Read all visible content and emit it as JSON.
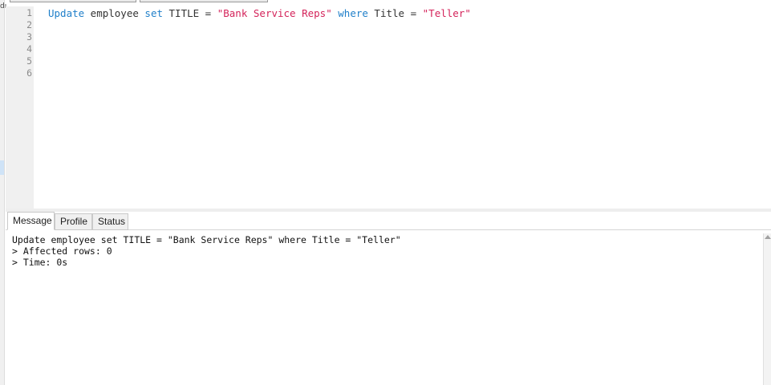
{
  "editor": {
    "line_numbers": [
      "1",
      "2",
      "3",
      "4",
      "5",
      "6"
    ],
    "code": {
      "kw_update": "Update",
      "txt_employee": " employee ",
      "kw_set": "set",
      "txt_title_eq": " TITLE = ",
      "str_value": "\"Bank Service Reps\"",
      "txt_space": " ",
      "kw_where": "where",
      "txt_where_eq": " Title = ",
      "str_teller": "\"Teller\""
    }
  },
  "tabs": {
    "message": "Message",
    "profile": "Profile",
    "status": "Status"
  },
  "messages": [
    "Update employee set TITLE = \"Bank Service Reps\" where Title = \"Teller\"",
    "> Affected rows: 0",
    "> Time: 0s"
  ],
  "colors": {
    "keyword": "#1f7fc9",
    "string": "#d4235a"
  },
  "icons": {
    "scroll_up": "chevron-up-icon"
  }
}
